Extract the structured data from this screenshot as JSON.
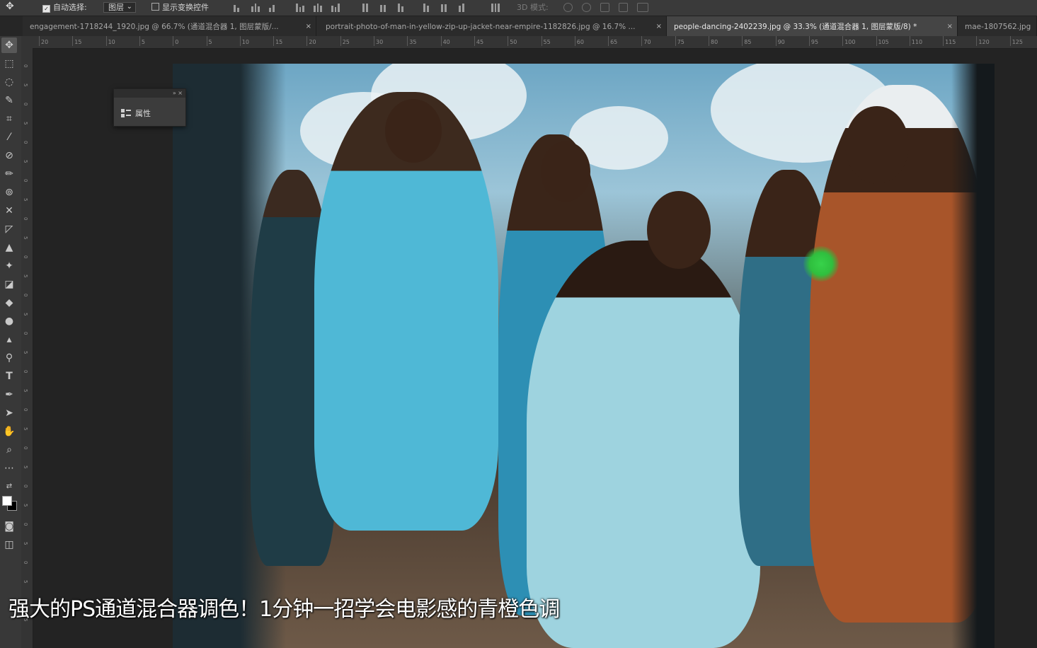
{
  "options_bar": {
    "move_tool_icon": "move-tool-icon",
    "auto_select_label": "自动选择:",
    "auto_select_checked": true,
    "auto_select_target": "图层",
    "show_transform_label": "显示变换控件",
    "show_transform_checked": false,
    "mode_3d_label": "3D 模式:"
  },
  "tabs": [
    {
      "label": "engagement-1718244_1920.jpg @ 66.7% (通道混合器 1, 图层蒙版/...",
      "close": "×",
      "active": false
    },
    {
      "label": "portrait-photo-of-man-in-yellow-zip-up-jacket-near-empire-1182826.jpg @ 16.7% ...",
      "close": "×",
      "active": false
    },
    {
      "label": "people-dancing-2402239.jpg @ 33.3% (通道混合器 1, 图层蒙版/8) *",
      "close": "×",
      "active": true
    },
    {
      "label": "mae-1807562.jpg",
      "close": "",
      "active": false
    }
  ],
  "toolbar": {
    "tools": [
      "move-tool-icon",
      "marquee-tool-icon",
      "lasso-tool-icon",
      "quick-select-tool-icon",
      "crop-tool-icon",
      "eyedropper-tool-icon",
      "healing-brush-icon",
      "brush-tool-icon",
      "stamp-tool-icon",
      "history-brush-icon",
      "eraser-icon",
      "gradient-tool-icon",
      "blur-tool-icon",
      "dodge-tool-icon",
      "pen-tool-icon",
      "type-tool-icon",
      "path-select-icon",
      "shape-tool-icon",
      "hand-tool-icon",
      "zoom-tool-icon",
      "more-tools-icon"
    ],
    "foreground_color": "#ffffff",
    "background_color": "#000000"
  },
  "ruler": {
    "h_ticks": [
      "20",
      "15",
      "10",
      "5",
      "0",
      "5",
      "10",
      "15",
      "20",
      "25",
      "30",
      "35",
      "40",
      "45",
      "50",
      "55",
      "60",
      "65",
      "70",
      "75",
      "80",
      "85",
      "90",
      "95",
      "100",
      "105",
      "110",
      "115",
      "120",
      "125"
    ],
    "v_ticks": [
      "0",
      "5",
      "0",
      "5",
      "0",
      "5",
      "0",
      "5",
      "0",
      "5",
      "0",
      "5",
      "0",
      "5",
      "0",
      "5",
      "0",
      "5",
      "0",
      "5",
      "0",
      "5",
      "0",
      "5",
      "0",
      "5",
      "0",
      "5",
      "0",
      "5"
    ]
  },
  "properties_panel": {
    "title": "属性",
    "controls": "»  ×"
  },
  "subtitle": "强大的PS通道混合器调色！1分钟一招学会电影感的青橙色调",
  "colors": {
    "ps_dark": "#262626",
    "panel": "#3c3c3c",
    "cursor_highlight": "#2fbf3e"
  }
}
